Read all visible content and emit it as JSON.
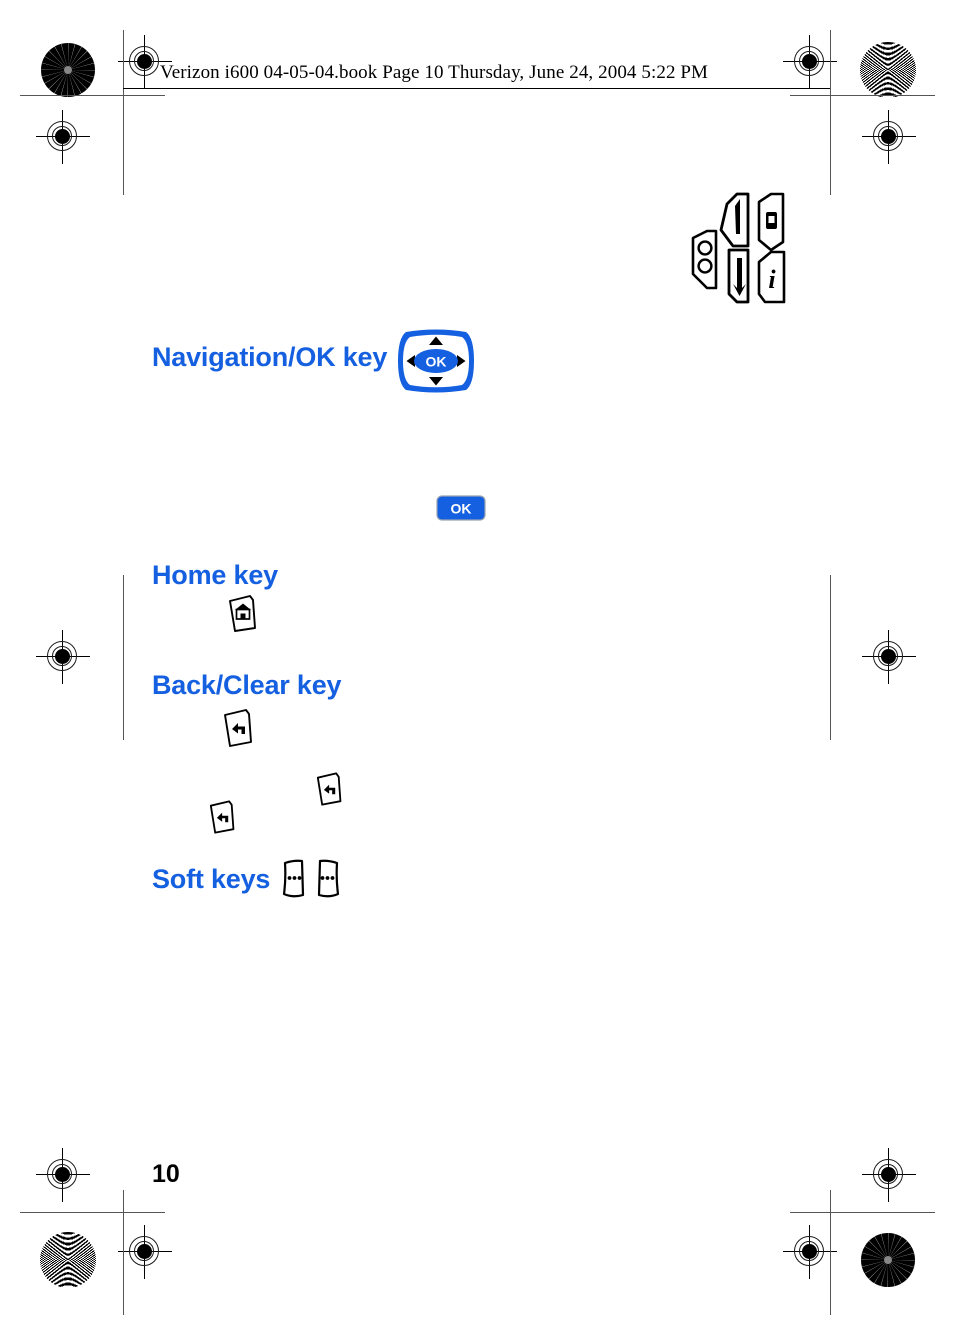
{
  "document": {
    "header_line": "Verizon i600 04-05-04.book  Page 10  Thursday, June 24, 2004  5:22 PM",
    "page_number": "10"
  },
  "colors": {
    "heading_blue": "#1560e0",
    "ok_fill": "#1560e0",
    "ok_text": "#ffffff",
    "ink": "#000000",
    "paper": "#ffffff",
    "rule_gray": "#555555"
  },
  "sections": [
    {
      "id": "navigation-ok-key",
      "heading": "Navigation/OK key",
      "icon": "navigation-dpad-with-ok-center"
    },
    {
      "id": "home-key",
      "heading": "Home key",
      "icon": "home-key-glyph"
    },
    {
      "id": "back-clear-key",
      "heading": "Back/Clear key",
      "icon": "back-arrow-key-glyph"
    },
    {
      "id": "soft-keys",
      "heading": "Soft keys",
      "icon": "soft-key-pair-glyph"
    }
  ],
  "inline_graphics": {
    "ok_button_label": "OK",
    "nav_ok_label": "OK",
    "info_key_label": "i",
    "arrow_up_label": "1",
    "arrow_down_label": "l"
  },
  "icon_names": {
    "navigation_key": "navigation-dpad-icon",
    "ok_button": "ok-button-icon",
    "home_key": "home-key-icon",
    "back_key": "back-clear-key-icon",
    "soft_key_left": "soft-key-left-icon",
    "soft_key_right": "soft-key-right-icon",
    "volume_key": "volume-side-key-icon",
    "up_key": "scroll-up-key-icon",
    "down_key": "scroll-down-key-icon",
    "phone_key": "phone-send-key-icon",
    "info_key": "info-key-icon",
    "registration_target": "registration-crosshair-icon",
    "resolution_star": "resolution-star-target-icon",
    "moire_circle": "moire-pattern-target-icon"
  }
}
